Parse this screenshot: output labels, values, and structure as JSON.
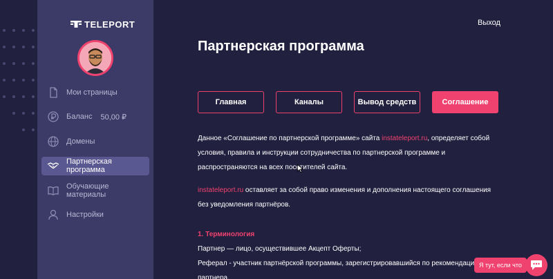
{
  "brand": {
    "name": "TELEPORT"
  },
  "sidebar": {
    "items": [
      {
        "label": "Мои страницы",
        "icon": "document-icon"
      },
      {
        "label": "Баланс",
        "value": "50,00 ₽",
        "icon": "ruble-coin-icon"
      },
      {
        "label": "Домены",
        "icon": "globe-icon"
      },
      {
        "label": "Партнерская программа",
        "icon": "handshake-icon",
        "active": true
      },
      {
        "label": "Обучающие материалы",
        "icon": "book-icon"
      },
      {
        "label": "Настройки",
        "icon": "user-icon"
      }
    ]
  },
  "header": {
    "exit_label": "Выход"
  },
  "main": {
    "title": "Партнерская программа",
    "tabs": [
      {
        "label": "Главная"
      },
      {
        "label": "Каналы"
      },
      {
        "label": "Вывод средств"
      },
      {
        "label": "Соглашение",
        "active": true
      }
    ],
    "agreement": {
      "p1_pre": "Данное «Соглашение по партнерской программе» сайта ",
      "p1_link": "instateleport.ru",
      "p1_post": ", определяет собой условия, правила и инструкции сотрудничества по партнерской программе и распространяются на всех посетителей сайта.",
      "p2_link": "instateleport.ru",
      "p2_post": " оставляет за собой право изменения и дополнения настоящего соглашения без уведомления партнёров.",
      "section_title": "1. Терминология",
      "term1": "Партнер — лицо, осуществившее Акцепт Оферты;",
      "term2": "Реферал - участник партнёрской программы, зарегистрировавшийся по рекомендации партнера."
    }
  },
  "help": {
    "bubble_text": "Я тут, если что"
  },
  "colors": {
    "accent": "#f0426e",
    "background": "#22203f",
    "sidebar": "#3c3a66",
    "active_item": "#5a5890"
  }
}
